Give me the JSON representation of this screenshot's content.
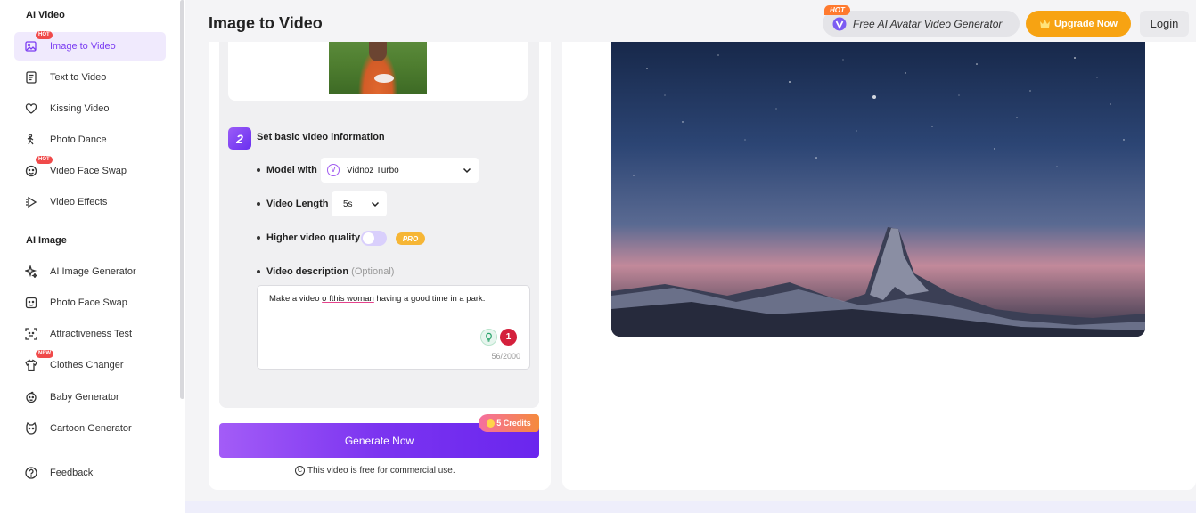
{
  "sidebar": {
    "sections": [
      {
        "title": "AI Video",
        "items": [
          {
            "label": "Image to Video",
            "icon": "image-video-icon",
            "badge": "HOT",
            "active": true
          },
          {
            "label": "Text to Video",
            "icon": "text-video-icon"
          },
          {
            "label": "Kissing Video",
            "icon": "kissing-icon"
          },
          {
            "label": "Photo Dance",
            "icon": "dance-icon"
          },
          {
            "label": "Video Face Swap",
            "icon": "face-swap-icon",
            "badge": "HOT"
          },
          {
            "label": "Video Effects",
            "icon": "effects-icon"
          }
        ]
      },
      {
        "title": "AI Image",
        "items": [
          {
            "label": "AI Image Generator",
            "icon": "sparkle-icon"
          },
          {
            "label": "Photo Face Swap",
            "icon": "photo-face-icon"
          },
          {
            "label": "Attractiveness Test",
            "icon": "scan-face-icon"
          },
          {
            "label": "Clothes Changer",
            "icon": "shirt-icon",
            "badge": "NEW"
          },
          {
            "label": "Baby Generator",
            "icon": "baby-icon"
          },
          {
            "label": "Cartoon Generator",
            "icon": "cartoon-icon"
          }
        ]
      }
    ],
    "feedback": "Feedback"
  },
  "header": {
    "title": "Image to Video",
    "promo_badge": "HOT",
    "promo_text": "Free AI Avatar Video Generator",
    "upgrade": "Upgrade Now",
    "login": "Login"
  },
  "form": {
    "step_number": "2",
    "step_title": "Set basic video information",
    "model_label": "Model with",
    "model_value": "Vidnoz Turbo",
    "length_label": "Video Length",
    "length_value": "5s",
    "quality_label": "Higher video quality",
    "quality_on": false,
    "pro_badge": "PRO",
    "desc_label": "Video description",
    "desc_optional": "(Optional)",
    "desc_value_parts": [
      "Make a video ",
      "o fthis woman",
      " having a good time in a park."
    ],
    "desc_counter": "56/2000",
    "grammar_count": "1",
    "generate": "Generate Now",
    "credits": "5 Credits",
    "free_note": "This video is free for commercial use."
  },
  "colors": {
    "accent": "#7b34f0",
    "upgrade": "#f7a312",
    "hot_badge": "#f04a4a"
  }
}
